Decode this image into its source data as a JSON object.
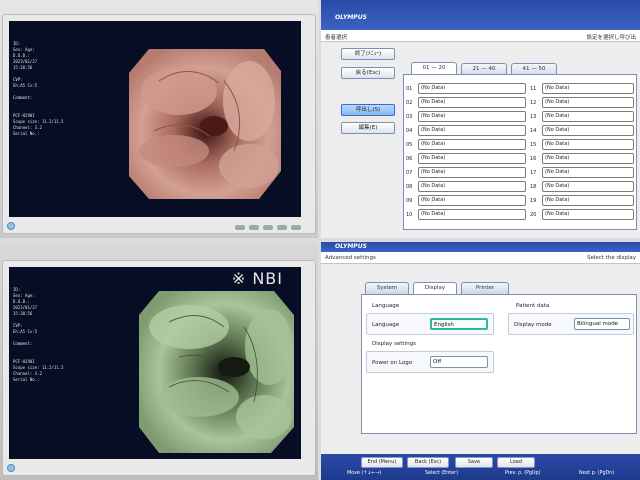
{
  "monitor_top": {
    "osd": [
      "ID:",
      "Sex:   Age:",
      "D.O.B.:",
      "2023/01/27",
      "15:20:56",
      "",
      "CVP:",
      "Eh:A5 Cv:5",
      "",
      "Comment:",
      "",
      "",
      "PCF-H290I",
      "Scope size: 11.2/11.5",
      "Channel:      3.2",
      "Serial No.:"
    ]
  },
  "monitor_bottom": {
    "nbi_label": "※ NBI",
    "osd": [
      "ID:",
      "Sex:   Age:",
      "D.O.B.:",
      "2023/01/27",
      "15:20:56",
      "",
      "CVP:",
      "Eh:A5 Cv:5",
      "",
      "Comment:",
      "",
      "",
      "PCF-H290I",
      "Scope size: 11.2/11.5",
      "Channel:      3.2",
      "Serial No.:"
    ]
  },
  "patient_select": {
    "logo": "OLYMPUS",
    "title": "患者選択",
    "hint": "設定を選択し呼び出",
    "buttons": {
      "exit": "終了(ﾒﾆｭｰ)",
      "back": "戻る(Esc)",
      "call": "呼出し(S)",
      "edit": "編集(E)"
    },
    "tabs": [
      "01 — 20",
      "21 — 40",
      "41 — 50"
    ],
    "rows_left": [
      {
        "num": "01",
        "value": "(No Data)"
      },
      {
        "num": "02",
        "value": "(No Data)"
      },
      {
        "num": "03",
        "value": "(No Data)"
      },
      {
        "num": "04",
        "value": "(No Data)"
      },
      {
        "num": "05",
        "value": "(No Data)"
      },
      {
        "num": "06",
        "value": "(No Data)"
      },
      {
        "num": "07",
        "value": "(No Data)"
      },
      {
        "num": "08",
        "value": "(No Data)"
      },
      {
        "num": "09",
        "value": "(No Data)"
      },
      {
        "num": "10",
        "value": "(No Data)"
      }
    ],
    "rows_right": [
      {
        "num": "11",
        "value": "(No Data)"
      },
      {
        "num": "12",
        "value": "(No Data)"
      },
      {
        "num": "13",
        "value": "(No Data)"
      },
      {
        "num": "14",
        "value": "(No Data)"
      },
      {
        "num": "15",
        "value": "(No Data)"
      },
      {
        "num": "16",
        "value": "(No Data)"
      },
      {
        "num": "17",
        "value": "(No Data)"
      },
      {
        "num": "18",
        "value": "(No Data)"
      },
      {
        "num": "19",
        "value": "(No Data)"
      },
      {
        "num": "20",
        "value": "(No Data)"
      }
    ]
  },
  "advanced": {
    "logo": "OLYMPUS",
    "title": "Advanced settings",
    "hint": "Select the display",
    "tabs": [
      "System",
      "Display",
      "Printer"
    ],
    "language_header": "Language",
    "language_label": "Language",
    "language_value": "English",
    "display_settings_header": "Display settings",
    "power_logo_label": "Power on Logo",
    "power_logo_value": "Off",
    "patient_data_header": "Patient data",
    "display_mode_label": "Display mode",
    "display_mode_value": "Bilingual mode",
    "footer_buttons": [
      "End (Menu)",
      "Back (Esc)",
      "Save",
      "Load"
    ],
    "footer_hints": [
      "Move (↑↓←→)",
      "Select (Enter)",
      "Prev. p. (PgUp)",
      "Next p. (PgDn)"
    ]
  },
  "colors": {
    "header_blue": "#2a4aa8",
    "focus_teal": "#2fb6a0",
    "selected_blue": "#8ab9f0"
  }
}
